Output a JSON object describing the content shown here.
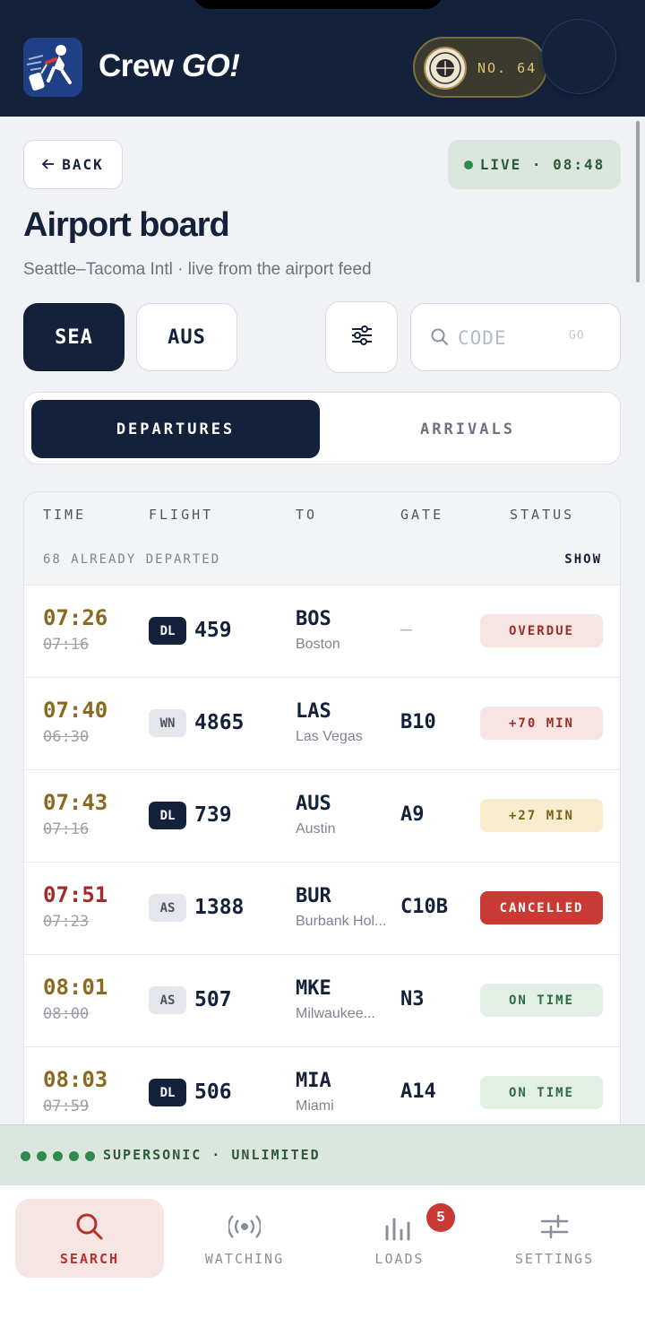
{
  "header": {
    "brand_main": "Crew ",
    "brand_go": "GO!",
    "badge_number": "NO. 64"
  },
  "toolbar": {
    "back_label": "BACK",
    "live_label": "LIVE · 08:48"
  },
  "page": {
    "title": "Airport board",
    "subtitle": "Seattle–Tacoma Intl · live from the airport feed"
  },
  "airports": [
    "SEA",
    "AUS"
  ],
  "search": {
    "placeholder": "CODE",
    "go_label": "GO"
  },
  "tabs": {
    "departures": "DEPARTURES",
    "arrivals": "ARRIVALS"
  },
  "board": {
    "columns": {
      "time": "TIME",
      "flight": "FLIGHT",
      "to": "TO",
      "gate": "GATE",
      "status": "STATUS"
    },
    "departed_note": "68 ALREADY DEPARTED",
    "show_label": "SHOW",
    "rows": [
      {
        "time_new": "07:26",
        "time_old": "07:16",
        "airline": "DL",
        "flight": "459",
        "dest_code": "BOS",
        "dest_city": "Boston",
        "gate": "—",
        "status": "OVERDUE"
      },
      {
        "time_new": "07:40",
        "time_old": "06:30",
        "airline": "WN",
        "flight": "4865",
        "dest_code": "LAS",
        "dest_city": "Las Vegas",
        "gate": "B10",
        "status": "+70 MIN"
      },
      {
        "time_new": "07:43",
        "time_old": "07:16",
        "airline": "DL",
        "flight": "739",
        "dest_code": "AUS",
        "dest_city": "Austin",
        "gate": "A9",
        "status": "+27 MIN"
      },
      {
        "time_new": "07:51",
        "time_old": "07:23",
        "airline": "AS",
        "flight": "1388",
        "dest_code": "BUR",
        "dest_city": "Burbank Hol...",
        "gate": "C10B",
        "status": "CANCELLED"
      },
      {
        "time_new": "08:01",
        "time_old": "08:00",
        "airline": "AS",
        "flight": "507",
        "dest_code": "MKE",
        "dest_city": "Milwaukee...",
        "gate": "N3",
        "status": "ON TIME"
      },
      {
        "time_new": "08:03",
        "time_old": "07:59",
        "airline": "DL",
        "flight": "506",
        "dest_code": "MIA",
        "dest_city": "Miami",
        "gate": "A14",
        "status": "ON TIME"
      }
    ]
  },
  "speed_strip": {
    "label": "SUPERSONIC · UNLIMITED"
  },
  "nav": {
    "items": [
      "SEARCH",
      "WATCHING",
      "LOADS",
      "SETTINGS"
    ],
    "loads_badge": "5"
  },
  "colors": {
    "navy": "#13213b",
    "gold": "#8a6a1f",
    "red": "#c83a33",
    "green": "#2e8a4e"
  },
  "icons": [
    "traveler-logo-icon",
    "seal-icon",
    "arrow-left-icon",
    "sliders-icon",
    "search-icon",
    "broadcast-icon",
    "bar-chart-icon",
    "adjustments-icon"
  ]
}
